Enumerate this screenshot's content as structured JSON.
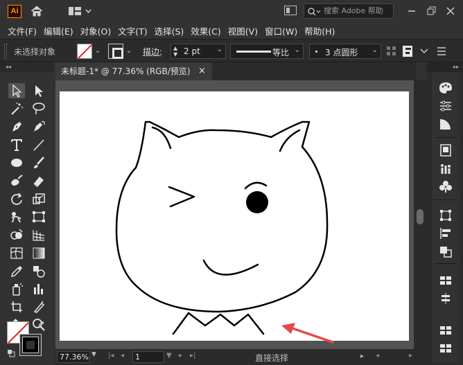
{
  "app": {
    "logo_text": "Ai",
    "search_placeholder": "搜索 Adobe 帮助"
  },
  "menu": [
    {
      "label": "文件(F)"
    },
    {
      "label": "编辑(E)"
    },
    {
      "label": "对象(O)"
    },
    {
      "label": "文字(T)"
    },
    {
      "label": "选择(S)"
    },
    {
      "label": "效果(C)"
    },
    {
      "label": "视图(V)"
    },
    {
      "label": "窗口(W)"
    },
    {
      "label": "帮助(H)"
    }
  ],
  "control": {
    "selection_status": "未选择对象",
    "stroke_label": "描边",
    "stroke_colon": ":",
    "stroke_weight": "2 pt",
    "profile_label": "等比",
    "brush_label": "3 点圆形",
    "caret": "⌄"
  },
  "document": {
    "tab_title": "未标题-1* @ 77.36% (RGB/预览)",
    "close_glyph": "×"
  },
  "status": {
    "zoom": "77.36%",
    "page": "1",
    "current_tool": "直接选择"
  },
  "colors": {
    "accent_arrow": "#e5484d",
    "logo_orange": "#ff9a00"
  },
  "icons": {
    "toolbar": [
      "direct-selection-icon",
      "selection-icon",
      "magic-wand-icon",
      "lasso-icon",
      "pen-icon",
      "curvature-icon",
      "type-icon",
      "line-segment-icon",
      "ellipse-icon",
      "paintbrush-icon",
      "blob-brush-icon",
      "eraser-icon",
      "rotate-icon",
      "scale-icon",
      "puppet-warp-icon",
      "free-transform-icon",
      "shape-builder-icon",
      "perspective-grid-icon",
      "mesh-icon",
      "gradient-icon",
      "eyedropper-icon",
      "blend-icon",
      "symbol-sprayer-icon",
      "column-graph-icon",
      "artboard-icon",
      "slice-icon",
      "hand-icon",
      "zoom-icon"
    ],
    "panels": [
      "color-icon",
      "properties-icon",
      "gradient-panel-icon",
      "layers-icon",
      "brushes-icon",
      "symbols-icon",
      "transform-icon",
      "align-icon",
      "pathfinder-icon",
      "swatches-icon"
    ]
  }
}
